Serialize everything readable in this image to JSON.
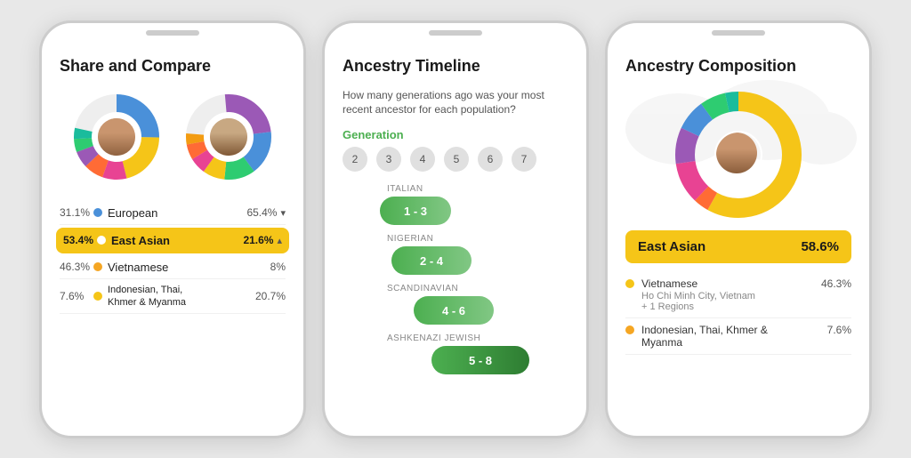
{
  "phone1": {
    "title": "Share and Compare",
    "rows": [
      {
        "pct_left": "31.1%",
        "color": "#4A90D9",
        "label": "European",
        "pct_right": "65.4%",
        "arrow": "▾",
        "highlight": false
      },
      {
        "pct_left": "53.4%",
        "color": "#F5C518",
        "label": "East Asian",
        "pct_right": "21.6%",
        "arrow": "▴",
        "highlight": true
      },
      {
        "pct_left": "46.3%",
        "color": "#F5A623",
        "label": "Vietnamese",
        "pct_right": "8%",
        "arrow": "",
        "highlight": false
      },
      {
        "pct_left": "7.6%",
        "color": "#F5C518",
        "label": "Indonesian, Thai,\nKhmer & Myanma",
        "pct_right": "20.7%",
        "arrow": "",
        "highlight": false
      }
    ]
  },
  "phone2": {
    "title": "Ancestry Timeline",
    "subtitle": "How many generations ago was your most recent ancestor for each population?",
    "gen_label": "Generation",
    "gen_numbers": [
      "2",
      "3",
      "4",
      "5",
      "6",
      "7"
    ],
    "items": [
      {
        "population": "ITALIAN",
        "range": "1 - 3",
        "class": "italian"
      },
      {
        "population": "NIGERIAN",
        "range": "2 - 4",
        "class": "nigerian"
      },
      {
        "population": "SCANDINAVIAN",
        "range": "4 - 6",
        "class": "scandinavian"
      },
      {
        "population": "ASHKENAZI JEWISH",
        "range": "5 - 8",
        "class": "ashkenazi"
      }
    ]
  },
  "phone3": {
    "title": "Ancestry Composition",
    "east_asian_label": "East Asian",
    "east_asian_pct": "58.6%",
    "sub_items": [
      {
        "color": "#F5C518",
        "label": "Vietnamese",
        "detail": "Ho Chi Minh City, Vietnam\n+ 1 Regions",
        "pct": "46.3%"
      },
      {
        "color": "#F5A623",
        "label": "Indonesian, Thai, Khmer &\nMyanma",
        "detail": "",
        "pct": "7.6%"
      }
    ]
  },
  "colors": {
    "donut1": [
      "#4A90D9",
      "#F5C518",
      "#E84393",
      "#FF6B35",
      "#9B59B6",
      "#2ECC71",
      "#F39C12",
      "#1ABC9C"
    ],
    "donut2": [
      "#9B59B6",
      "#4A90D9",
      "#2ECC71",
      "#F5C518",
      "#E84393",
      "#FF6B35",
      "#1ABC9C",
      "#F39C12"
    ],
    "donut3_outer": [
      "#F5C518",
      "#FF6B35",
      "#E84393",
      "#9B59B6",
      "#4A90D9",
      "#2ECC71",
      "#1ABC9C"
    ],
    "donut3_inner": [
      "#F5C518",
      "#F5A623",
      "#E84393",
      "#2ECC71",
      "#4A90D9",
      "#9B59B6"
    ]
  }
}
